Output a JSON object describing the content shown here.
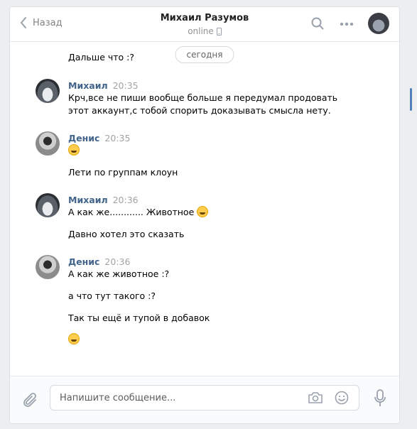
{
  "header": {
    "back_label": "Назад",
    "title": "Михаил Разумов",
    "status": "online"
  },
  "date_divider": "сегодня",
  "messages": [
    {
      "text": "Дальше что :?"
    },
    {
      "author": "Михаил",
      "time": "20:35",
      "text": "Крч,все не пиши вообще больше я передумал продовать этот аккаунт,с тобой спорить доказывать смысла нету."
    },
    {
      "author": "Денис",
      "time": "20:35",
      "text": "Лети по группам клоун"
    },
    {
      "author": "Михаил",
      "time": "20:36",
      "text": "А как же............ Животное",
      "text2": "Давно хотел это сказать"
    },
    {
      "author": "Денис",
      "time": "20:36",
      "text": "А как же животное :?",
      "text2": "а что тут такого :?",
      "text3": "Так ты ещё и тупой в добавок"
    }
  ],
  "composer": {
    "placeholder": "Напишите сообщение..."
  },
  "colors": {
    "author": "#42648b",
    "accent": "#5181b8",
    "background": "#edeef0"
  },
  "icons": [
    "chevron-left-icon",
    "search-icon",
    "more-icon",
    "phone-icon",
    "attach-icon",
    "camera-icon",
    "smile-icon",
    "microphone-icon"
  ]
}
